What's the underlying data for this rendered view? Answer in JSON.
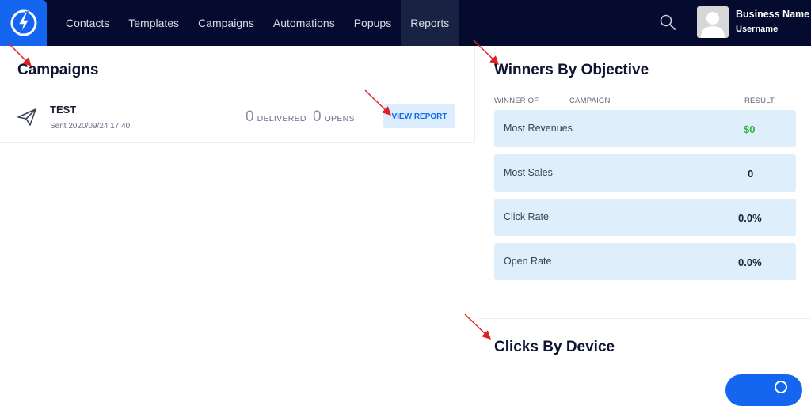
{
  "nav": {
    "items": [
      {
        "label": "Contacts",
        "active": false
      },
      {
        "label": "Templates",
        "active": false
      },
      {
        "label": "Campaigns",
        "active": false
      },
      {
        "label": "Automations",
        "active": false
      },
      {
        "label": "Popups",
        "active": false
      },
      {
        "label": "Reports",
        "active": true
      }
    ]
  },
  "account": {
    "business_name": "Business Name",
    "username": "Username"
  },
  "campaigns": {
    "title": "Campaigns",
    "item": {
      "name": "TEST",
      "sent": "Sent 2020/09/24 17:40",
      "delivered_value": "0",
      "delivered_label": "DELIVERED",
      "opens_value": "0",
      "opens_label": "OPENS",
      "button_label": "VIEW REPORT"
    }
  },
  "winners": {
    "title": "Winners By Objective",
    "headers": {
      "winner_of": "WINNER OF",
      "campaign": "CAMPAIGN",
      "result": "RESULT"
    },
    "rows": [
      {
        "label": "Most Revenues",
        "value": "$0"
      },
      {
        "label": "Most Sales",
        "value": "0"
      },
      {
        "label": "Click Rate",
        "value": "0.0%"
      },
      {
        "label": "Open Rate",
        "value": "0.0%"
      }
    ]
  },
  "clicks": {
    "title": "Clicks By Device"
  },
  "colors": {
    "topbar": "#040b2e",
    "brand": "#1466f0",
    "row_bg": "#deeefb",
    "positive": "#2fb344",
    "annotation": "#e02020"
  }
}
